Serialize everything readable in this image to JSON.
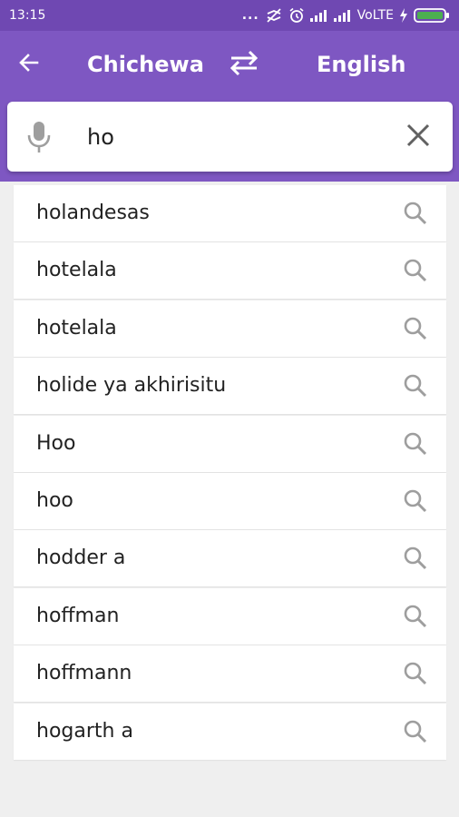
{
  "status_bar": {
    "time": "13:15",
    "dots": "...",
    "network": "VoLTE",
    "icons": [
      "sync-off-icon",
      "alarm-icon",
      "signal-icon",
      "signal-icon",
      "charging-icon",
      "battery-icon"
    ]
  },
  "toolbar": {
    "back_icon": "arrow-back-icon",
    "source_language": "Chichewa",
    "swap_icon": "swap-horiz-icon",
    "target_language": "English"
  },
  "search": {
    "mic_icon": "mic-icon",
    "query": "ho",
    "clear_icon": "close-icon"
  },
  "suggestions": [
    {
      "text": "holandesas"
    },
    {
      "text": "hotelala"
    },
    {
      "text": "hotelala"
    },
    {
      "text": "holide ya akhirisitu"
    },
    {
      "text": "Hoo"
    },
    {
      "text": "hoo"
    },
    {
      "text": "hodder a"
    },
    {
      "text": "hoffman"
    },
    {
      "text": "hoffmann"
    },
    {
      "text": "hogarth a"
    }
  ],
  "colors": {
    "status_bar": "#6f48b2",
    "app_bar": "#7e57c2",
    "background": "#efefef",
    "card": "#ffffff",
    "icon_gray": "#9e9e9e",
    "battery_green": "#4caf50"
  }
}
